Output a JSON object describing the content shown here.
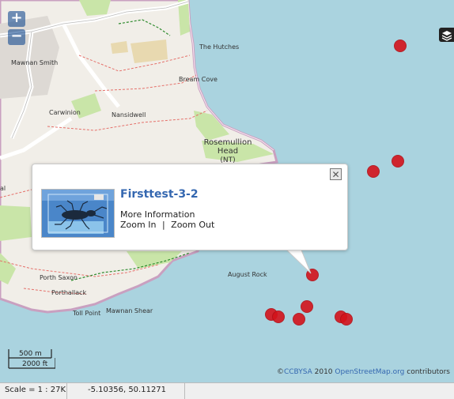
{
  "map": {
    "places": {
      "mawnan_smith": "Mawnan Smith",
      "the_hutches": "The Hutches",
      "bream_cove": "Bream Cove",
      "carwinion": "Carwinion",
      "nansidwell": "Nansidwell",
      "rosemullion_head": "Rosemullion Head",
      "rosemullion_line1": "Rosemullion",
      "rosemullion_line2": "Head",
      "rosemullion_line3": "(NT)",
      "al": "al",
      "porth_saxon": "Porth Saxon",
      "porthallack": "Porthallack",
      "august_rock": "August Rock",
      "toll_point": "Toll Point",
      "mawnan_shear": "Mawnan Shear"
    },
    "zoom_in_label": "+",
    "zoom_out_label": "−",
    "layer_switcher_icon": "layers-icon",
    "marker_color": "#d4131b"
  },
  "popup": {
    "title": "Firsttest-3-2",
    "more_info": "More Information",
    "zoom_in": "Zoom In",
    "separator": "|",
    "zoom_out": "Zoom Out",
    "close_label": "✕"
  },
  "scale_bar": {
    "metric": "500 m",
    "imperial": "2000 ft"
  },
  "attribution": {
    "copyright": "©",
    "license": "CCBYSA",
    "year": " 2010 ",
    "source": "OpenStreetMap.org",
    "suffix": " contributors"
  },
  "status_bar": {
    "scale": "Scale = 1 : 27K",
    "coordinates": "-5.10356, 50.11271"
  }
}
